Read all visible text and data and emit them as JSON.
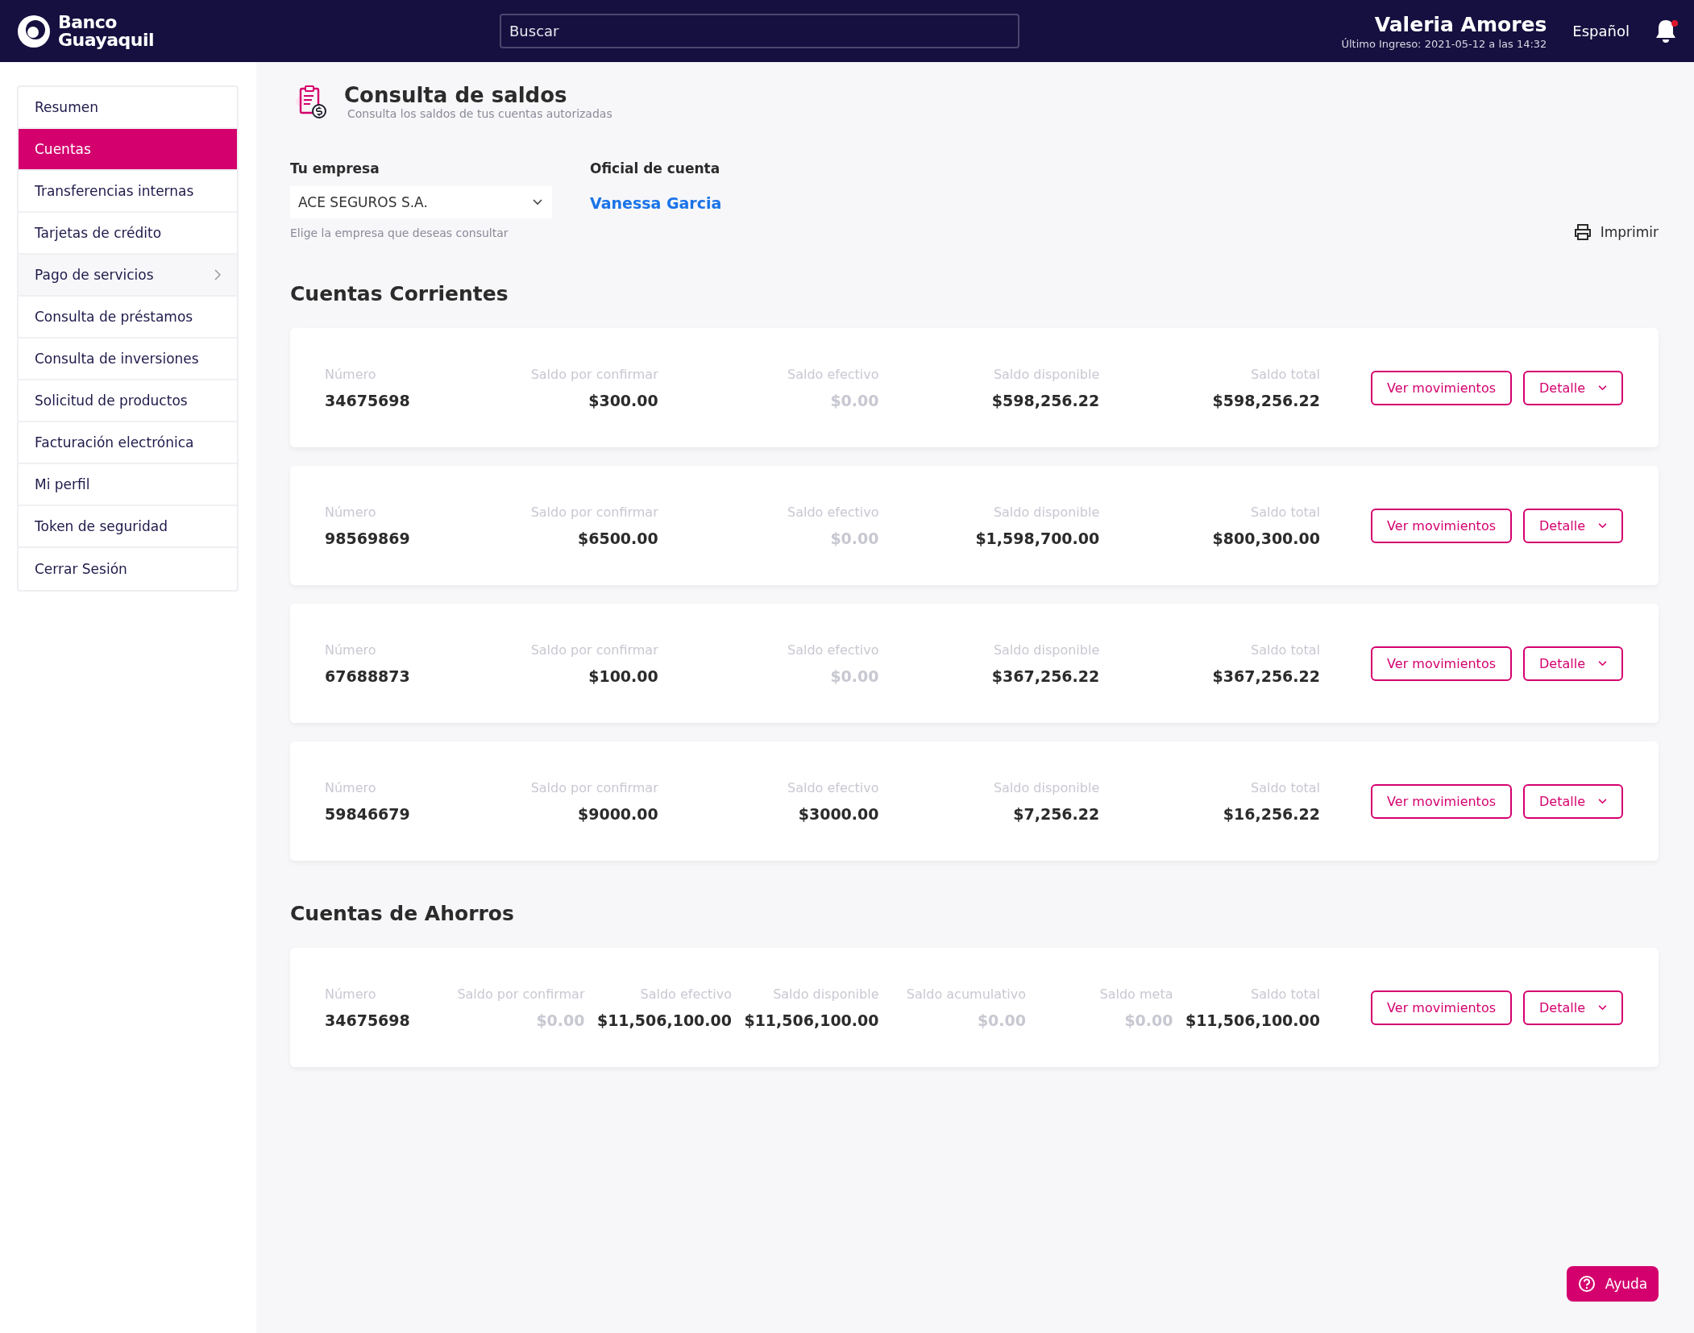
{
  "header": {
    "brand_line_1": "Banco",
    "brand_line_2": "Guayaquil",
    "search": {
      "placeholder": "Buscar"
    },
    "user_name": "Valeria Amores",
    "last_login": "Último Ingreso: 2021-05-12 a las 14:32",
    "language": "Español",
    "notifications_unread": true
  },
  "sidebar": {
    "items": [
      {
        "label": "Resumen",
        "selected": false,
        "kind": "link"
      },
      {
        "label": "Cuentas",
        "selected": true,
        "kind": "link"
      },
      {
        "label": "Transferencias internas",
        "selected": false,
        "kind": "link"
      },
      {
        "label": "Tarjetas de crédito",
        "selected": false,
        "kind": "link"
      },
      {
        "label": "Pago de servicios",
        "selected": false,
        "kind": "submenu"
      },
      {
        "label": "Consulta de préstamos",
        "selected": false,
        "kind": "link"
      },
      {
        "label": "Consulta de inversiones",
        "selected": false,
        "kind": "link"
      },
      {
        "label": "Solicitud de productos",
        "selected": false,
        "kind": "link"
      },
      {
        "label": "Facturación electrónica",
        "selected": false,
        "kind": "link"
      },
      {
        "label": "Mi perfil",
        "selected": false,
        "kind": "link"
      },
      {
        "label": "Token de seguridad",
        "selected": false,
        "kind": "link"
      },
      {
        "label": "Cerrar Sesión",
        "selected": false,
        "kind": "link"
      }
    ]
  },
  "page": {
    "title": "Consulta de saldos",
    "subtitle": "Consulta los saldos de tus cuentas autorizadas",
    "company": {
      "label": "Tu empresa",
      "value": "ACE SEGUROS S.A.",
      "hint": "Elige la empresa que deseas consultar"
    },
    "officer": {
      "label": "Oficial de cuenta",
      "name": "Vanessa Garcia"
    },
    "print_label": "Imprimir",
    "sections": [
      {
        "title": "Cuentas Corrientes",
        "accounts": [
          {
            "fields": [
              {
                "label": "Número",
                "value": "34675698",
                "muted": false
              },
              {
                "label": "Saldo por confirmar",
                "value": "$300.00",
                "muted": false
              },
              {
                "label": "Saldo efectivo",
                "value": "$0.00",
                "muted": true
              },
              {
                "label": "Saldo disponible",
                "value": "$598,256.22",
                "muted": false
              },
              {
                "label": "Saldo total",
                "value": "$598,256.22",
                "muted": false
              }
            ],
            "movements_label": "Ver movimientos",
            "detail_label": "Detalle"
          },
          {
            "fields": [
              {
                "label": "Número",
                "value": "98569869",
                "muted": false
              },
              {
                "label": "Saldo por confirmar",
                "value": "$6500.00",
                "muted": false
              },
              {
                "label": "Saldo efectivo",
                "value": "$0.00",
                "muted": true
              },
              {
                "label": "Saldo disponible",
                "value": "$1,598,700.00",
                "muted": false
              },
              {
                "label": "Saldo total",
                "value": "$800,300.00",
                "muted": false
              }
            ],
            "movements_label": "Ver movimientos",
            "detail_label": "Detalle"
          },
          {
            "fields": [
              {
                "label": "Número",
                "value": "67688873",
                "muted": false
              },
              {
                "label": "Saldo por confirmar",
                "value": "$100.00",
                "muted": false
              },
              {
                "label": "Saldo efectivo",
                "value": "$0.00",
                "muted": true
              },
              {
                "label": "Saldo disponible",
                "value": "$367,256.22",
                "muted": false
              },
              {
                "label": "Saldo total",
                "value": "$367,256.22",
                "muted": false
              }
            ],
            "movements_label": "Ver movimientos",
            "detail_label": "Detalle"
          },
          {
            "fields": [
              {
                "label": "Número",
                "value": "59846679",
                "muted": false
              },
              {
                "label": "Saldo por confirmar",
                "value": "$9000.00",
                "muted": false
              },
              {
                "label": "Saldo efectivo",
                "value": "$3000.00",
                "muted": false
              },
              {
                "label": "Saldo disponible",
                "value": "$7,256.22",
                "muted": false
              },
              {
                "label": "Saldo total",
                "value": "$16,256.22",
                "muted": false
              }
            ],
            "movements_label": "Ver movimientos",
            "detail_label": "Detalle"
          }
        ]
      },
      {
        "title": "Cuentas de Ahorros",
        "accounts": [
          {
            "fields": [
              {
                "label": "Número",
                "value": "34675698",
                "muted": false
              },
              {
                "label": "Saldo por confirmar",
                "value": "$0.00",
                "muted": true
              },
              {
                "label": "Saldo efectivo",
                "value": "$11,506,100.00",
                "muted": false
              },
              {
                "label": "Saldo disponible",
                "value": "$11,506,100.00",
                "muted": false
              },
              {
                "label": "Saldo acumulativo",
                "value": "$0.00",
                "muted": true
              },
              {
                "label": "Saldo meta",
                "value": "$0.00",
                "muted": true
              },
              {
                "label": "Saldo total",
                "value": "$11,506,100.00",
                "muted": false
              }
            ],
            "movements_label": "Ver movimientos",
            "detail_label": "Detalle"
          }
        ]
      }
    ]
  },
  "help_label": "Ayuda"
}
